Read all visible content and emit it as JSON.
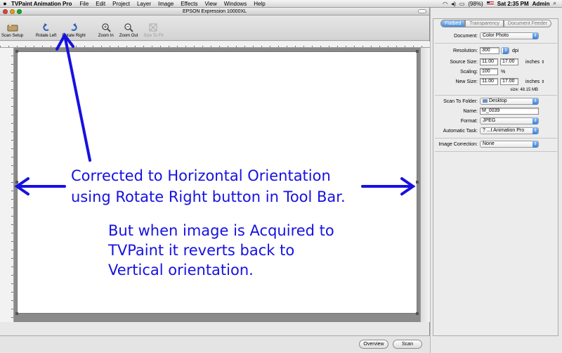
{
  "menubar": {
    "apple": "",
    "app_name": "TVPaint Animation Pro",
    "items": [
      "File",
      "Edit",
      "Project",
      "Layer",
      "Image",
      "Effects",
      "View",
      "Windows",
      "Help"
    ],
    "battery": "(98%)",
    "clock": "Sat 2:35 PM",
    "user": "Admin"
  },
  "window": {
    "title": "EPSON Expression 10000XL"
  },
  "toolbar": {
    "scan_setup": "Scan Setup",
    "rotate_left": "Rotate Left",
    "rotate_right": "Rotate Right",
    "zoom_in": "Zoom In",
    "zoom_out": "Zoom Out",
    "size_to_fit": "Size To Fit"
  },
  "buttons": {
    "overview": "Overview",
    "scan": "Scan"
  },
  "panel": {
    "tabs": [
      "Flatbed",
      "Transparency",
      "Document Feeder"
    ],
    "document_label": "Document:",
    "document_value": "Color Photo",
    "resolution_label": "Resolution:",
    "resolution_value": "300",
    "resolution_unit": "dpi",
    "source_size_label": "Source Size:",
    "source_w": "11.00",
    "source_h": "17.00",
    "source_unit": "inches",
    "scaling_label": "Scaling:",
    "scaling_value": "100",
    "scaling_unit": "%",
    "new_size_label": "New Size:",
    "new_w": "11.00",
    "new_h": "17.00",
    "new_unit": "inches",
    "file_size": "size: 48.15 MB",
    "folder_label": "Scan To Folder:",
    "folder_value": "Desktop",
    "name_label": "Name:",
    "name_value": "M_0039",
    "format_label": "Format:",
    "format_value": "JPEG",
    "task_label": "Automatic Task:",
    "task_value": "? ...t Animation Pro",
    "correction_label": "Image Correction:",
    "correction_value": "None"
  },
  "annotations": {
    "line1": "Corrected to Horizontal Orientation",
    "line2": "using Rotate Right button in Tool Bar.",
    "line3": "But when image is Acquired to",
    "line4": "TVPaint it reverts back to",
    "line5": "Vertical orientation.",
    "color": "#1611e0"
  },
  "colors": {
    "accent": "#4a8cd9",
    "annotation": "#1611e0"
  }
}
